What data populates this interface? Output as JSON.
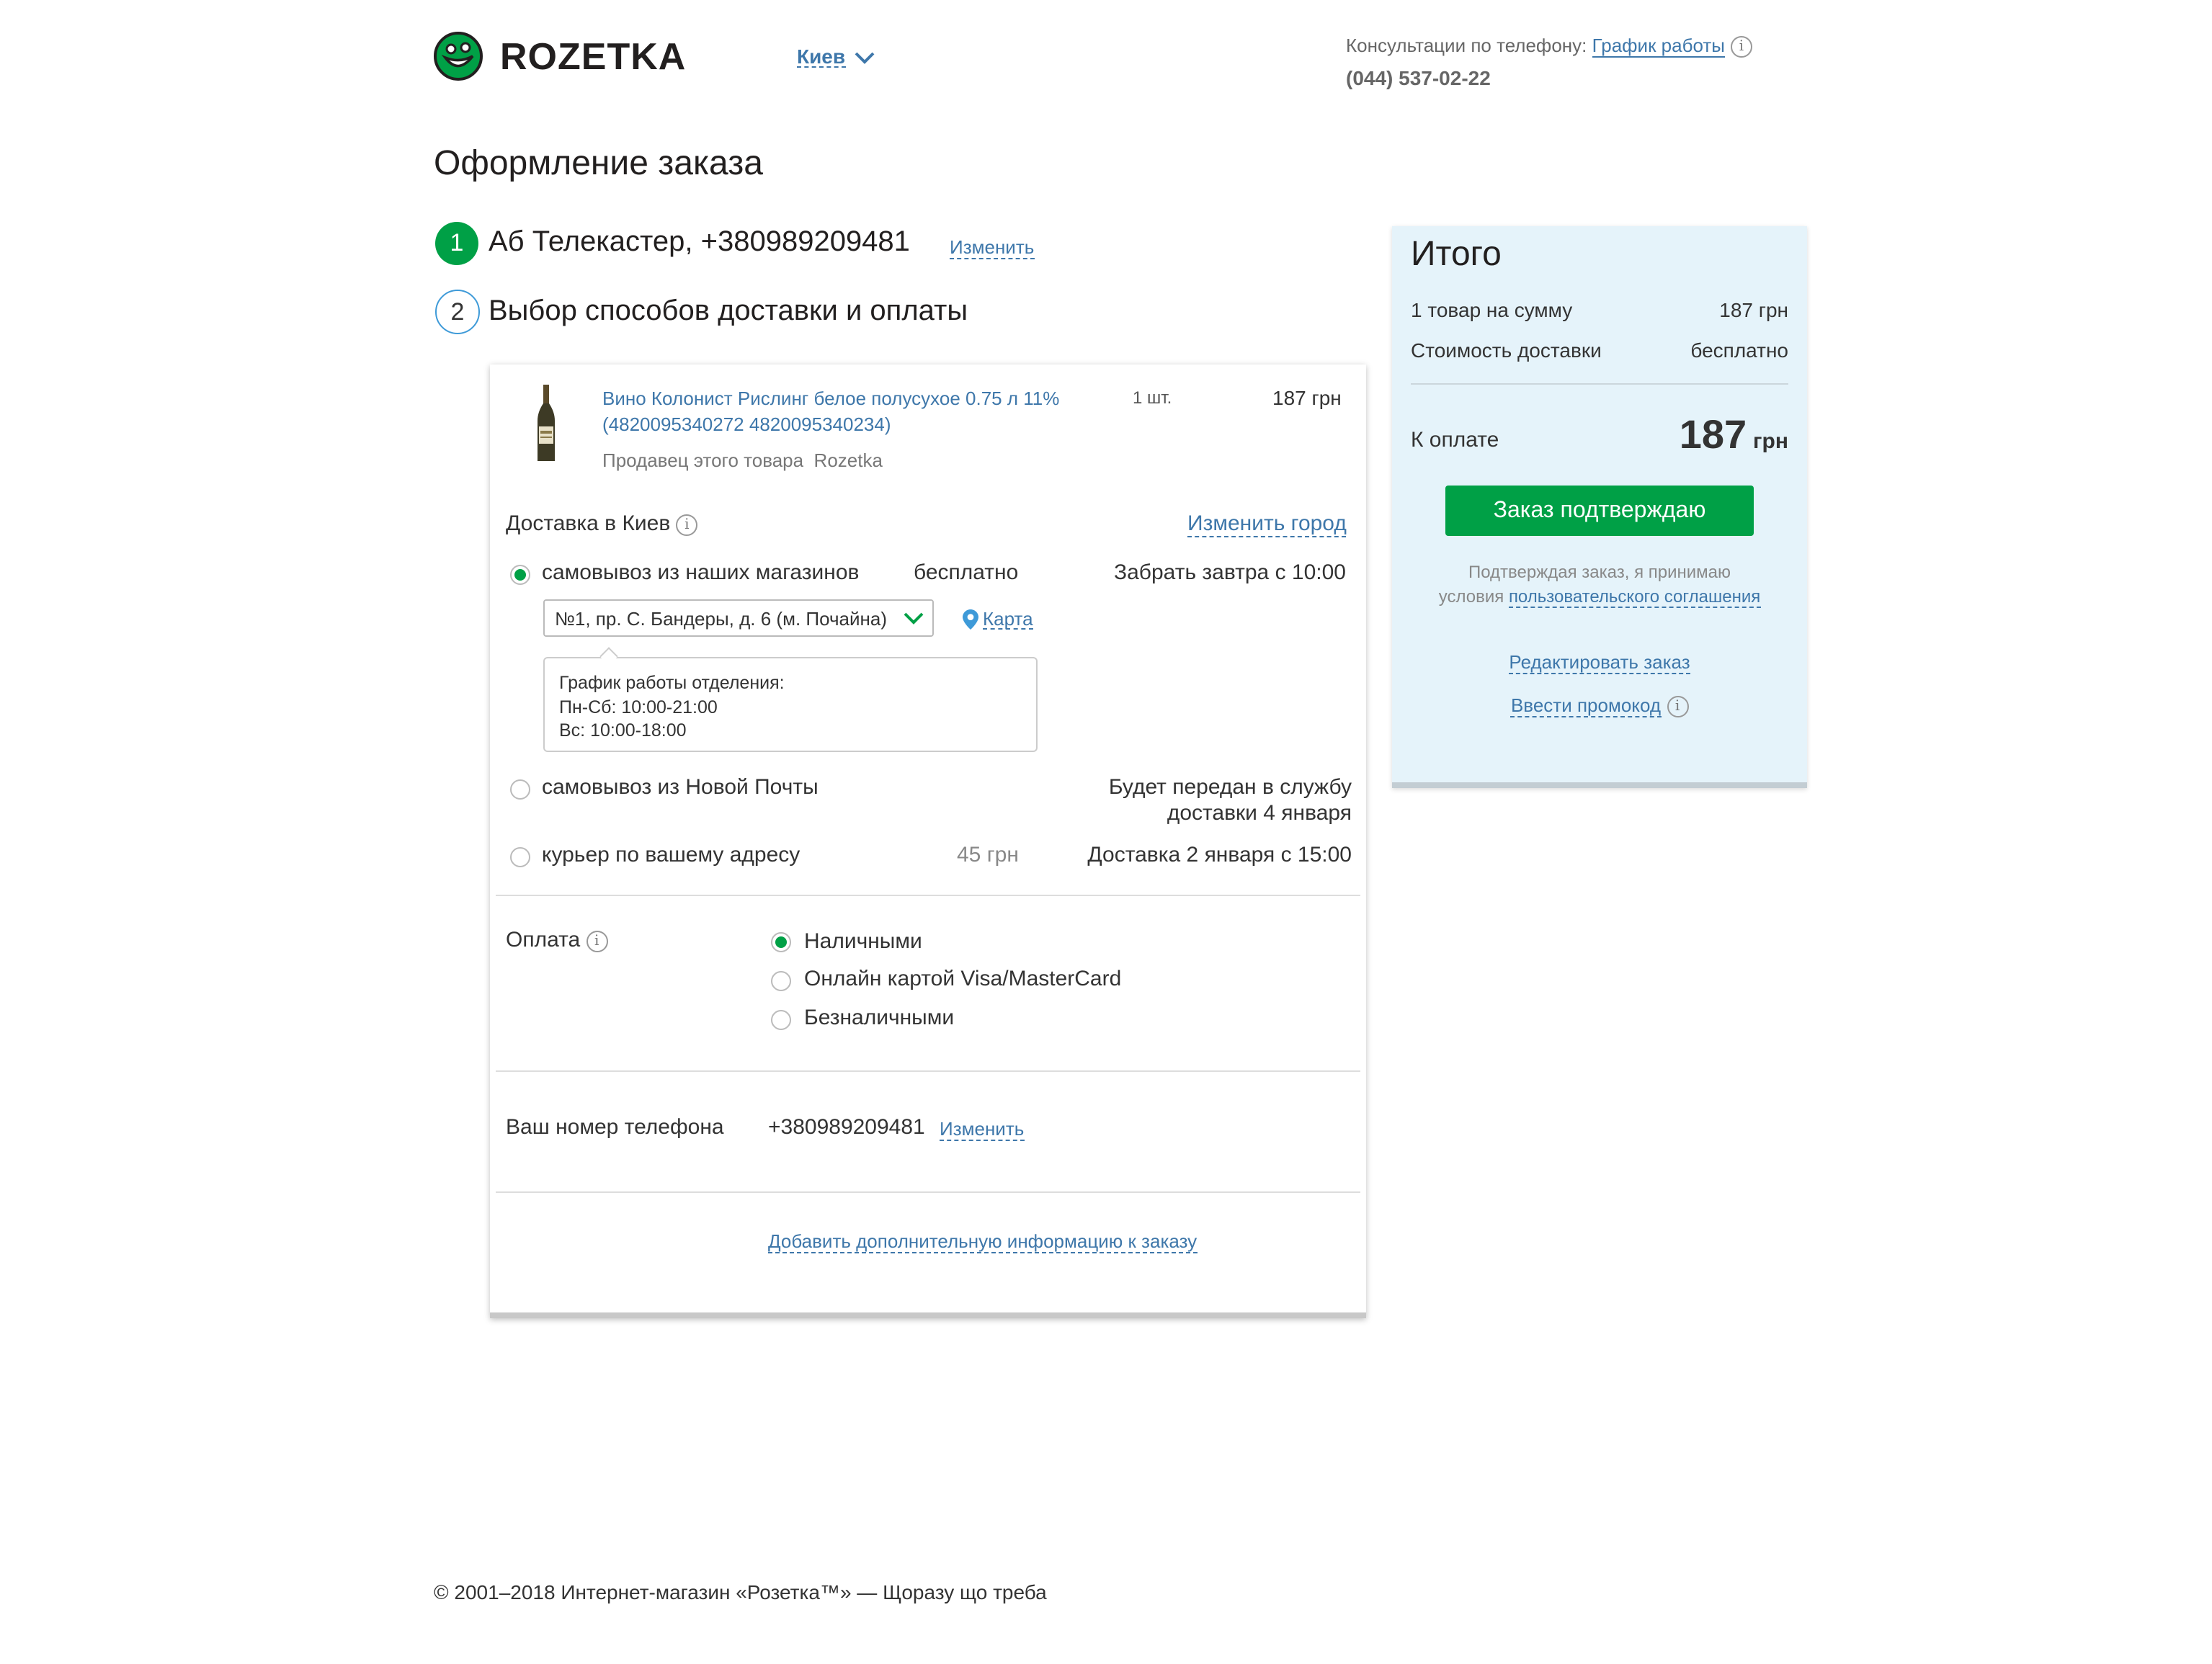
{
  "header": {
    "logo_text": "ROZETKA",
    "city": "Киев",
    "consult_label": "Консультации по телефону:",
    "schedule_link": "График работы",
    "phone": "(044) 537-02-22"
  },
  "page_title": "Оформление заказа",
  "step1": {
    "number": "1",
    "text": "Аб Телекастер, +380989209481",
    "edit": "Изменить"
  },
  "step2": {
    "number": "2",
    "text": "Выбор способов доставки и оплаты"
  },
  "product": {
    "name": "Вино Колонист Рислинг белое полусухое 0.75 л 11% (4820095340272 4820095340234)",
    "seller": "Продавец этого товара  Rozetka",
    "qty": "1 шт.",
    "price": "187 грн"
  },
  "delivery": {
    "title": "Доставка в Киев",
    "change_city": "Изменить город",
    "options": [
      {
        "label": "самовывоз из наших магазинов",
        "price": "бесплатно",
        "note": "Забрать завтра с 10:00",
        "selected": true
      },
      {
        "label": "самовывоз из Новой Почты",
        "price": "",
        "note_line1": "Будет передан в службу",
        "note_line2": "доставки 4 января",
        "selected": false
      },
      {
        "label": "курьер по вашему адресу",
        "price": "45 грн",
        "note": "Доставка 2 января с 15:00",
        "selected": false
      }
    ],
    "store_select": "№1, пр. С. Бандеры, д. 6 (м. Почайна)",
    "map_link": "Карта",
    "schedule_title": "График работы отделения:",
    "schedule_weekdays": "Пн-Сб: 10:00-21:00",
    "schedule_sunday": "Вс: 10:00-18:00"
  },
  "payment": {
    "title": "Оплата",
    "options": [
      {
        "label": "Наличными",
        "selected": true
      },
      {
        "label": "Онлайн картой Visa/MasterCard",
        "selected": false
      },
      {
        "label": "Безналичными",
        "selected": false
      }
    ]
  },
  "phone_section": {
    "label": "Ваш номер телефона",
    "value": "+380989209481",
    "edit": "Изменить"
  },
  "add_info_link": "Добавить дополнительную информацию к заказу",
  "summary": {
    "title": "Итого",
    "items_label": "1 товар на сумму",
    "items_value": "187 грн",
    "delivery_label": "Стоимость доставки",
    "delivery_value": "бесплатно",
    "to_pay_label": "К оплате",
    "to_pay_amount": "187",
    "to_pay_currency": "грн",
    "confirm_button": "Заказ подтверждаю",
    "agree_line1": "Подтверждая заказ, я принимаю",
    "agree_prefix": "условия",
    "agree_link": "пользовательского соглашения",
    "edit_order": "Редактировать заказ",
    "promo": "Ввести промокод"
  },
  "footer": "© 2001–2018 Интернет-магазин «Розетка™» — Щоразу що треба",
  "colors": {
    "accent_green": "#00a046",
    "link_blue": "#3e77aa",
    "summary_bg": "#e5f3fa"
  },
  "icons": [
    "logo-smile-icon",
    "chevron-down-icon",
    "info-icon",
    "map-pin-icon",
    "wine-bottle-image"
  ]
}
